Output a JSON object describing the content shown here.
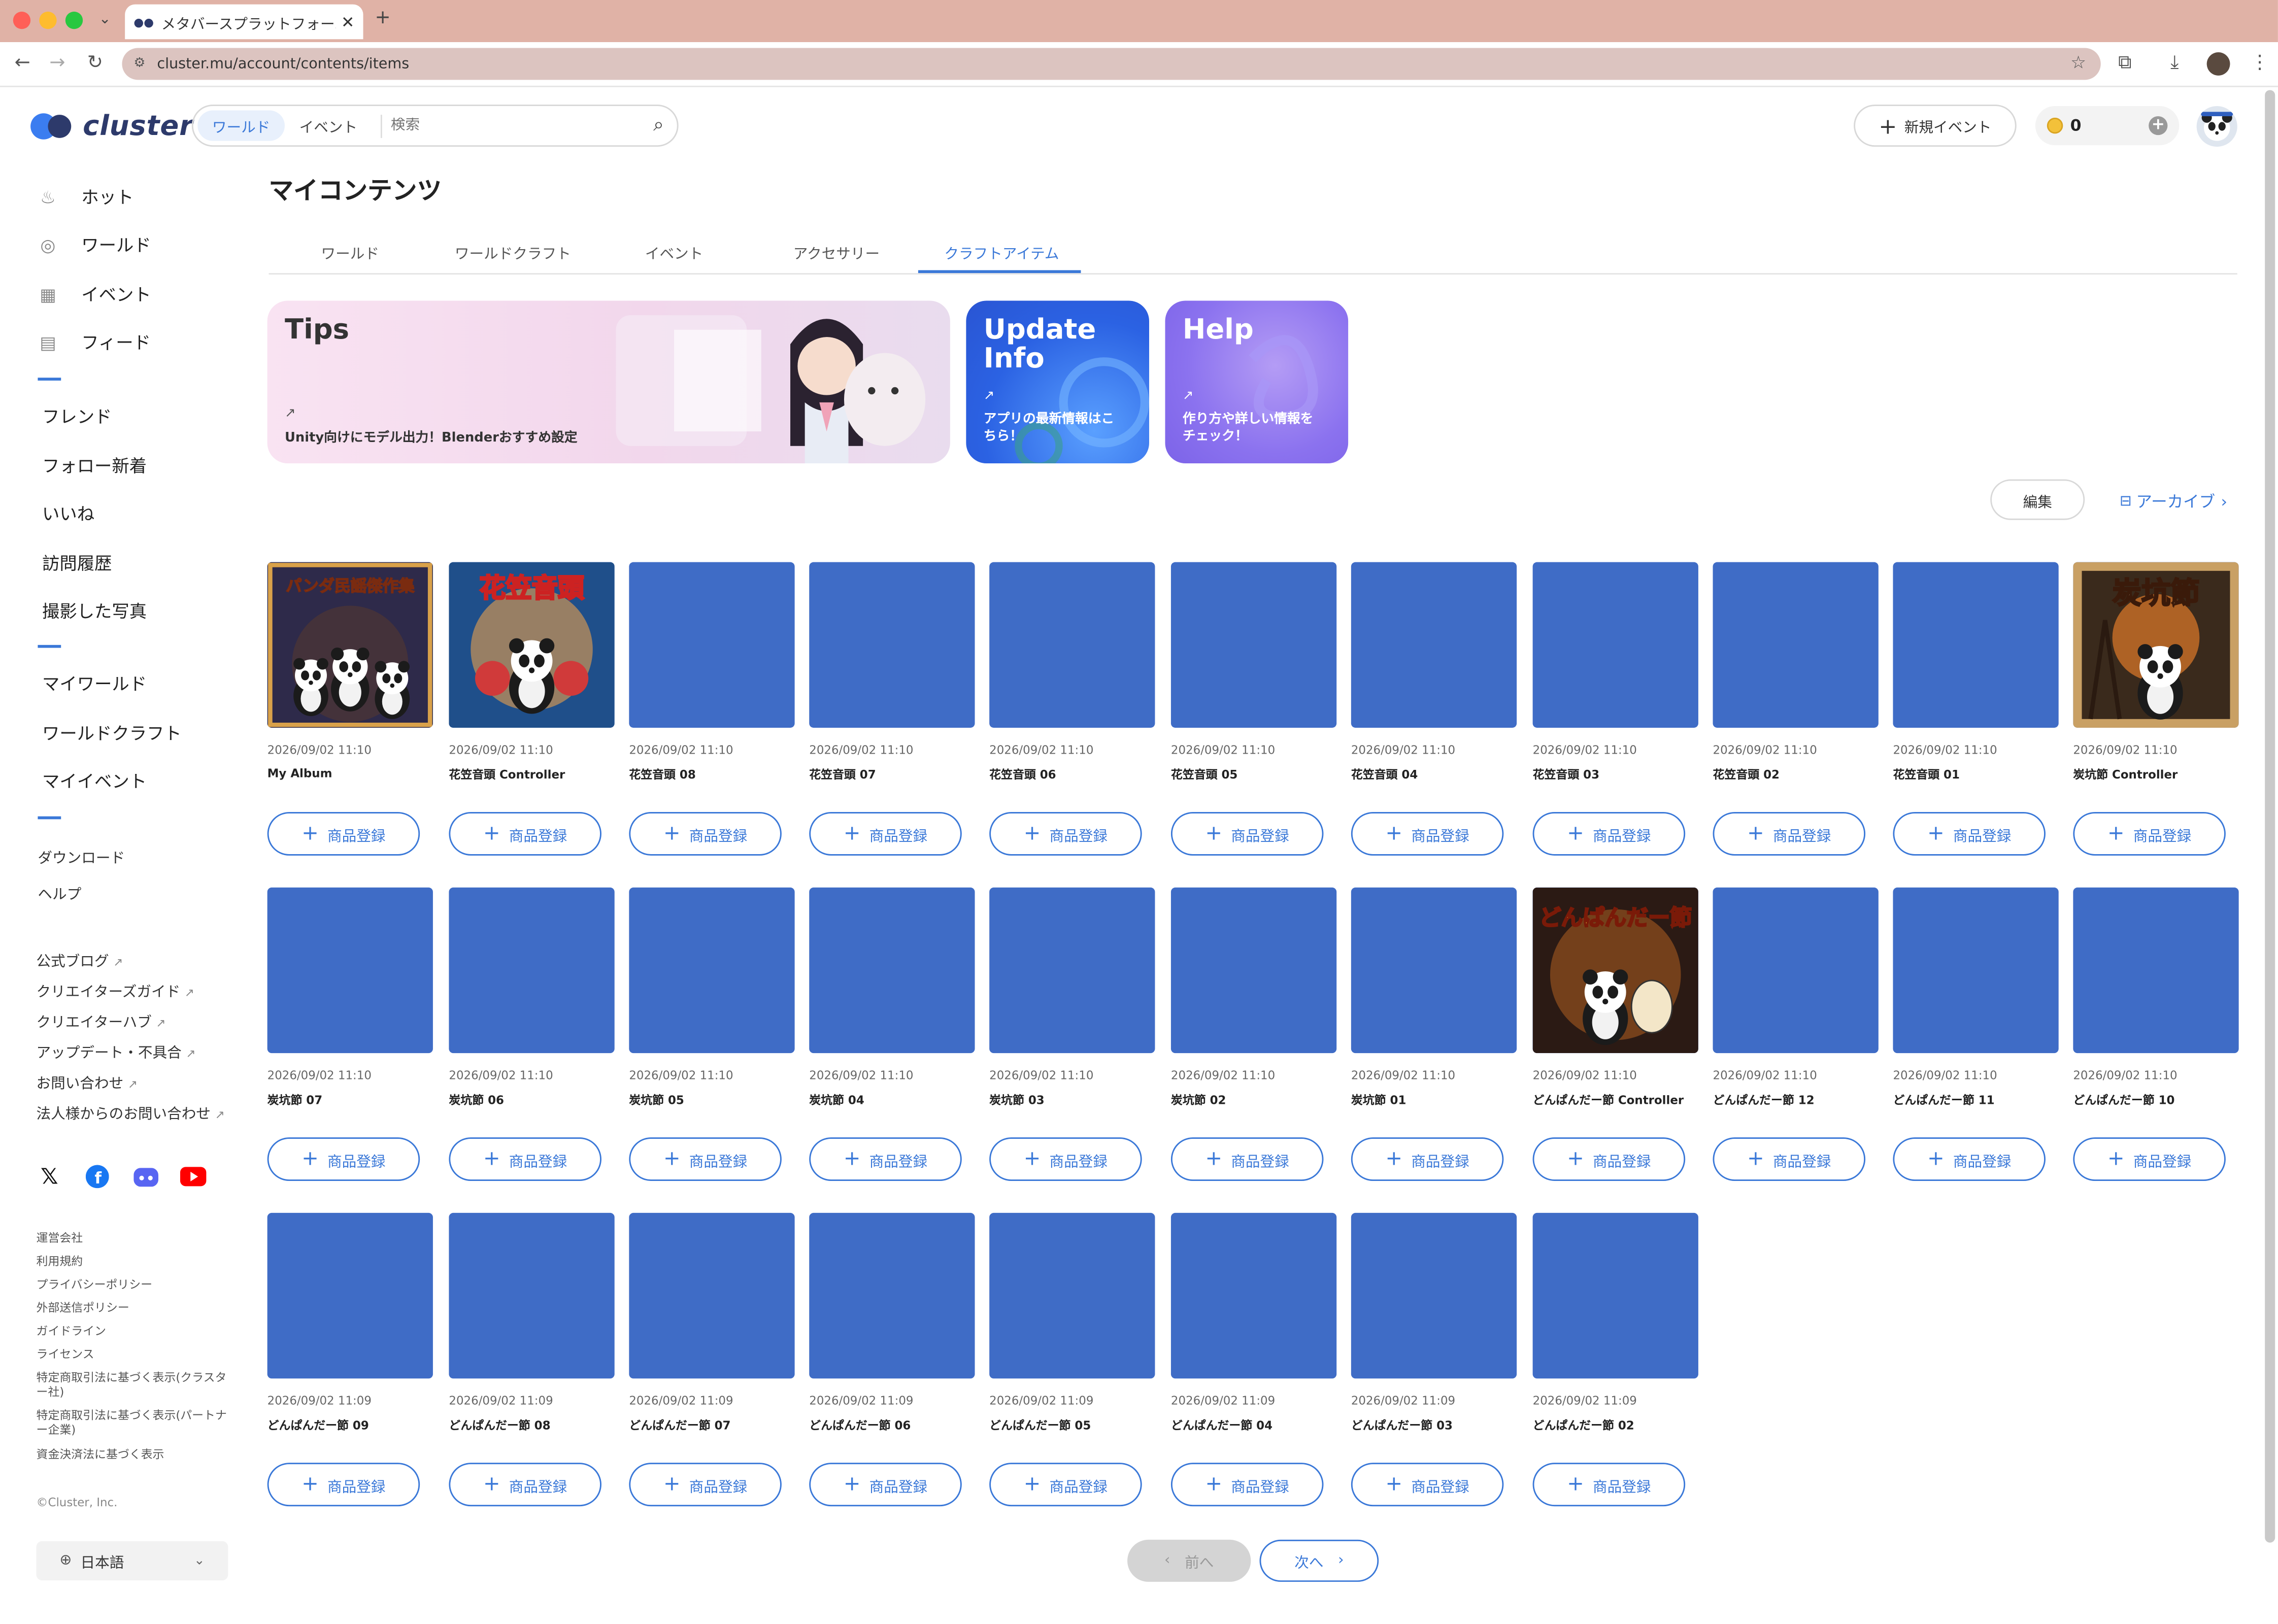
{
  "browser": {
    "tab_title": "メタバースプラットフォーム clu",
    "tab_close": "✕",
    "new_tab": "+",
    "url": "cluster.mu/account/contents/items",
    "tab_search_icon": "chevron-down-icon"
  },
  "header": {
    "logo_text": "cluster",
    "search_tabs": [
      "ワールド",
      "イベント"
    ],
    "search_placeholder": "検索",
    "new_event_label": "新規イベント",
    "coin_count": "0"
  },
  "sidebar": {
    "main": [
      "ホット",
      "ワールド",
      "イベント",
      "フィード"
    ],
    "social": [
      "フレンド",
      "フォロー新着",
      "いいね",
      "訪問履歴",
      "撮影した写真"
    ],
    "mine": [
      "マイワールド",
      "ワールドクラフト",
      "マイイベント"
    ],
    "misc": [
      "ダウンロード",
      "ヘルプ"
    ],
    "external": [
      "公式ブログ",
      "クリエイターズガイド",
      "クリエイターハブ",
      "アップデート・不具合",
      "お問い合わせ",
      "法人様からのお問い合わせ"
    ],
    "legal": [
      "運営会社",
      "利用規約",
      "プライバシーポリシー",
      "外部送信ポリシー",
      "ガイドライン",
      "ライセンス",
      "特定商取引法に基づく表示(クラスター社)",
      "特定商取引法に基づく表示(パートナー企業)",
      "資金決済法に基づく表示"
    ],
    "copyright": "©Cluster, Inc.",
    "language": "日本語"
  },
  "main": {
    "title": "マイコンテンツ",
    "tabs": [
      "ワールド",
      "ワールドクラフト",
      "イベント",
      "アクセサリー",
      "クラフトアイテム"
    ],
    "active_tab": "クラフトアイテム",
    "banners": {
      "tips": {
        "title": "Tips",
        "desc": "Unity向けにモデル出力！Blenderおすすめ設定"
      },
      "update": {
        "title_line1": "Update",
        "title_line2": "Info",
        "desc_line1": "アプリの最新情報はこ",
        "desc_line2": "ちら！"
      },
      "help": {
        "title": "Help",
        "desc_line1": "作り方や詳しい情報を",
        "desc_line2": "チェック！"
      }
    },
    "edit_label": "編集",
    "archive_label": "アーカイブ",
    "register_label": "商品登録",
    "items": [
      {
        "date": "2026/09/02 11:10",
        "name": "My Album",
        "art": "album"
      },
      {
        "date": "2026/09/02 11:10",
        "name": "花笠音頭 Controller",
        "art": "hanagasa"
      },
      {
        "date": "2026/09/02 11:10",
        "name": "花笠音頭 08",
        "art": ""
      },
      {
        "date": "2026/09/02 11:10",
        "name": "花笠音頭 07",
        "art": ""
      },
      {
        "date": "2026/09/02 11:10",
        "name": "花笠音頭 06",
        "art": ""
      },
      {
        "date": "2026/09/02 11:10",
        "name": "花笠音頭 05",
        "art": ""
      },
      {
        "date": "2026/09/02 11:10",
        "name": "花笠音頭 04",
        "art": ""
      },
      {
        "date": "2026/09/02 11:10",
        "name": "花笠音頭 03",
        "art": ""
      },
      {
        "date": "2026/09/02 11:10",
        "name": "花笠音頭 02",
        "art": ""
      },
      {
        "date": "2026/09/02 11:10",
        "name": "花笠音頭 01",
        "art": ""
      },
      {
        "date": "2026/09/02 11:10",
        "name": "炭坑節 Controller",
        "art": "tankou"
      },
      {
        "date": "2026/09/02 11:10",
        "name": "炭坑節 07",
        "art": ""
      },
      {
        "date": "2026/09/02 11:10",
        "name": "炭坑節 06",
        "art": ""
      },
      {
        "date": "2026/09/02 11:10",
        "name": "炭坑節 05",
        "art": ""
      },
      {
        "date": "2026/09/02 11:10",
        "name": "炭坑節 04",
        "art": ""
      },
      {
        "date": "2026/09/02 11:10",
        "name": "炭坑節 03",
        "art": ""
      },
      {
        "date": "2026/09/02 11:10",
        "name": "炭坑節 02",
        "art": ""
      },
      {
        "date": "2026/09/02 11:10",
        "name": "炭坑節 01",
        "art": ""
      },
      {
        "date": "2026/09/02 11:10",
        "name": "どんぱんだー節 Controller",
        "art": "donpan"
      },
      {
        "date": "2026/09/02 11:10",
        "name": "どんぱんだー節 12",
        "art": ""
      },
      {
        "date": "2026/09/02 11:10",
        "name": "どんぱんだー節 11",
        "art": ""
      },
      {
        "date": "2026/09/02 11:10",
        "name": "どんぱんだー節 10",
        "art": ""
      },
      {
        "date": "2026/09/02 11:09",
        "name": "どんぱんだー節 09",
        "art": ""
      },
      {
        "date": "2026/09/02 11:09",
        "name": "どんぱんだー節 08",
        "art": ""
      },
      {
        "date": "2026/09/02 11:09",
        "name": "どんぱんだー節 07",
        "art": ""
      },
      {
        "date": "2026/09/02 11:09",
        "name": "どんぱんだー節 06",
        "art": ""
      },
      {
        "date": "2026/09/02 11:09",
        "name": "どんぱんだー節 05",
        "art": ""
      },
      {
        "date": "2026/09/02 11:09",
        "name": "どんぱんだー節 04",
        "art": ""
      },
      {
        "date": "2026/09/02 11:09",
        "name": "どんぱんだー節 03",
        "art": ""
      },
      {
        "date": "2026/09/02 11:09",
        "name": "どんぱんだー節 02",
        "art": ""
      }
    ],
    "art_text": {
      "album": "パンダ民謡傑作集",
      "hanagasa": "花笠音頭",
      "tankou": "炭坑節",
      "donpan": "どんぱんだー節"
    },
    "pagination": {
      "prev": "前へ",
      "next": "次へ"
    }
  },
  "colors": {
    "accent": "#3a78d8",
    "placeholder_tile": "#3f6cc6"
  }
}
